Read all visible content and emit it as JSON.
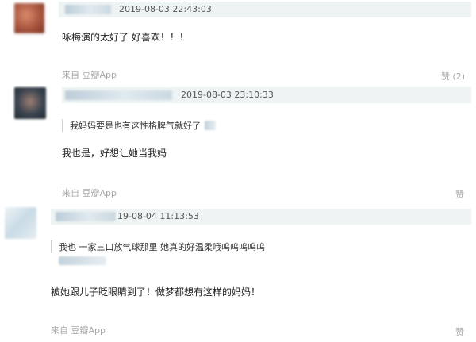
{
  "comments": [
    {
      "timestamp": "2019-08-03 22:43:03",
      "text": "咏梅演的太好了 好喜欢！！！",
      "source": "来自 豆瓣App",
      "like": "赞 (2)"
    },
    {
      "timestamp": "2019-08-03 23:10:33",
      "quote": "我妈妈要是也有这性格脾气就好了",
      "text": "我也是，好想让她当我妈",
      "source": "来自 豆瓣App",
      "like": "赞"
    },
    {
      "timestamp": "19-08-04 11:13:53",
      "quote": "我也 一家三口放气球那里 她真的好温柔哦呜呜呜呜呜",
      "text": "被她跟儿子眨眼睛到了！做梦都想有这样的妈妈！",
      "source": "来自 豆瓣App",
      "like": "赞"
    }
  ],
  "colors": {
    "meta_bar": "#eef3f3",
    "avatar1": "#b0604a",
    "avatar2": "#2f3a45",
    "avatar3": "#c9dbe6",
    "secondary_text": "#a8a8a8"
  }
}
